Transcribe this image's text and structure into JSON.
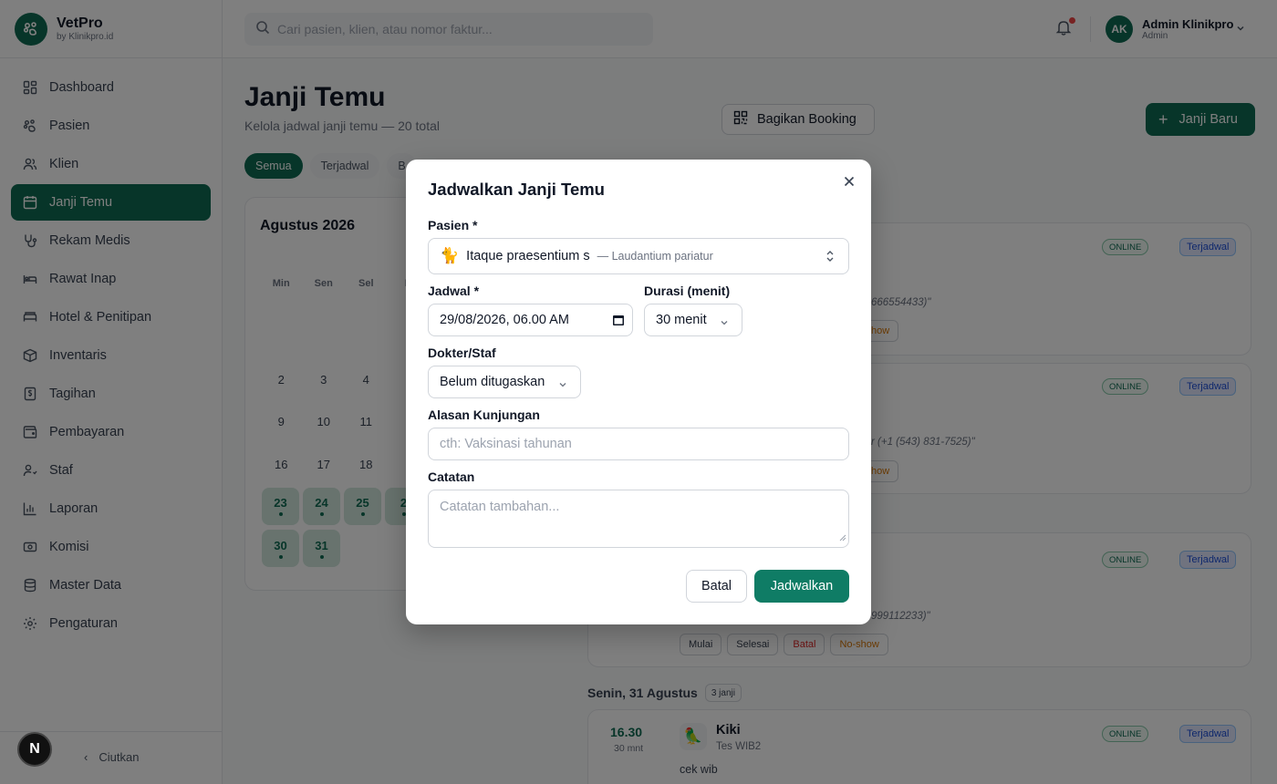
{
  "brand": {
    "name": "VetPro",
    "sub": "by Klinikpro.id"
  },
  "sidebar": {
    "items": [
      {
        "label": "Dashboard",
        "icon": "dashboard-icon"
      },
      {
        "label": "Pasien",
        "icon": "paw-icon"
      },
      {
        "label": "Klien",
        "icon": "users-icon"
      },
      {
        "label": "Janji Temu",
        "icon": "calendar-icon",
        "active": true
      },
      {
        "label": "Rekam Medis",
        "icon": "stethoscope-icon"
      },
      {
        "label": "Rawat Inap",
        "icon": "bed-icon"
      },
      {
        "label": "Hotel & Penitipan",
        "icon": "hotel-icon"
      },
      {
        "label": "Inventaris",
        "icon": "box-icon"
      },
      {
        "label": "Tagihan",
        "icon": "invoice-icon"
      },
      {
        "label": "Pembayaran",
        "icon": "wallet-icon"
      },
      {
        "label": "Staf",
        "icon": "staff-icon"
      },
      {
        "label": "Laporan",
        "icon": "chart-icon"
      },
      {
        "label": "Komisi",
        "icon": "coins-icon"
      },
      {
        "label": "Master Data",
        "icon": "database-icon"
      },
      {
        "label": "Pengaturan",
        "icon": "gear-icon"
      }
    ],
    "collapse_label": "Ciutkan",
    "next_badge": "N"
  },
  "topbar": {
    "search_placeholder": "Cari pasien, klien, atau nomor faktur...",
    "user_initials": "AK",
    "user_name": "Admin Klinikpro",
    "user_role": "Admin"
  },
  "page": {
    "title": "Janji Temu",
    "subtitle": "Kelola jadwal janji temu — 20 total",
    "share_label": "Bagikan Booking",
    "new_label": "Janji Baru",
    "filters": [
      "Semua",
      "Terjadwal",
      "B"
    ]
  },
  "calendar": {
    "month": "Agustus 2026",
    "weekdays": [
      "Min",
      "Sen",
      "Sel",
      "R"
    ],
    "rows": [
      [
        "2",
        "3",
        "4",
        ""
      ],
      [
        "9",
        "10",
        "11",
        "1"
      ],
      [
        "16",
        "17",
        "18",
        "1"
      ],
      [
        "23",
        "24",
        "25",
        "2"
      ],
      [
        "30",
        "31",
        "",
        ""
      ]
    ]
  },
  "appointments": {
    "badge_online": "ONLINE",
    "badge_status": "Terjadwal",
    "quote1": "666554433)\"",
    "quote2": "r (+1 (543) 831-7525)\"",
    "quote3": "999112233)\"",
    "noshow_partial": "how",
    "actions": [
      "Mulai",
      "Selesai",
      "Batal",
      "No-show"
    ],
    "day_header": "Senin, 31 Agustus",
    "day_count": "3 janji",
    "next": {
      "time": "16.30",
      "duration": "30 mnt",
      "emoji": "🦜",
      "pet": "Kiki",
      "owner": "Tes WIB2",
      "reason": "cek wib"
    }
  },
  "modal": {
    "title": "Jadwalkan Janji Temu",
    "patient_label": "Pasien *",
    "patient_emoji": "🐈",
    "patient_name": "Itaque praesentium s",
    "patient_sub": "— Laudantium pariatur",
    "schedule_label": "Jadwal *",
    "schedule_value": "29/08/2026, 06.00 AM",
    "duration_label": "Durasi (menit)",
    "duration_value": "30 menit",
    "doctor_label": "Dokter/Staf",
    "doctor_value": "Belum ditugaskan",
    "reason_label": "Alasan Kunjungan",
    "reason_placeholder": "cth: Vaksinasi tahunan",
    "notes_label": "Catatan",
    "notes_placeholder": "Catatan tambahan...",
    "cancel_label": "Batal",
    "submit_label": "Jadwalkan"
  },
  "colors": {
    "brand": "#0f6b52",
    "overlay": "rgba(0,0,0,0.5)"
  }
}
